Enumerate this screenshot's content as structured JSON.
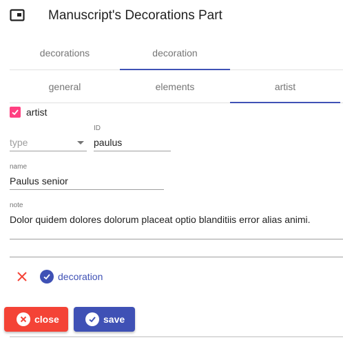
{
  "header": {
    "title": "Manuscript's Decorations Part",
    "icon": "web-asset-icon"
  },
  "tabs": [
    "decorations",
    "decoration"
  ],
  "subtabs": [
    "general",
    "elements",
    "artist"
  ],
  "artist_checkbox": {
    "label": "artist",
    "checked": true
  },
  "type_select": {
    "placeholder": "type"
  },
  "id_field": {
    "label": "ID",
    "value": "paulus"
  },
  "name_field": {
    "label": "name",
    "value": "Paulus senior"
  },
  "note_field": {
    "label": "note",
    "value": "Dolor quidem dolores dolorum placeat optio blanditiis error alias animi."
  },
  "row_actions": {
    "link": "decoration"
  },
  "buttons": {
    "close": "close",
    "save": "save"
  },
  "colors": {
    "accent": "#3f51b5",
    "warn": "#f44336",
    "checkbox": "#ff4081"
  }
}
